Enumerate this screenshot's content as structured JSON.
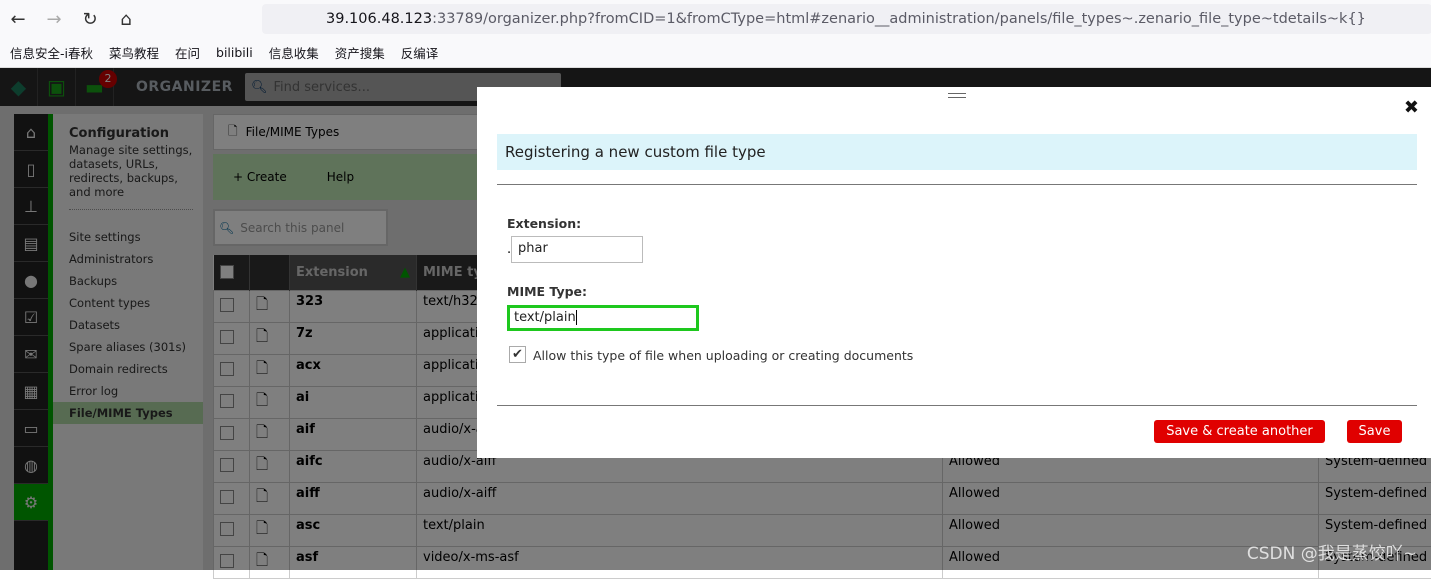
{
  "browser": {
    "url_host": "39.106.48.123",
    "url_rest": ":33789/organizer.php?fromCID=1&fromCType=html#zenario__administration/panels/file_types~.zenario_file_type~tdetails~k{}",
    "bookmarks": [
      "信息安全-i春秋",
      "菜鸟教程",
      "在问",
      "bilibili",
      "信息收集",
      "资产搜集",
      "反编译"
    ]
  },
  "topbar": {
    "badge": "2",
    "title": "ORGANIZER",
    "find_placeholder": "Find services..."
  },
  "config": {
    "title": "Configuration",
    "desc": "Manage site settings, datasets, URLs, redirects, backups, and more",
    "items": [
      "Site settings",
      "Administrators",
      "Backups",
      "Content types",
      "Datasets",
      "Spare aliases (301s)",
      "Domain redirects",
      "Error log",
      "File/MIME Types"
    ]
  },
  "panel": {
    "title": "File/MIME Types",
    "create": "+ Create",
    "help": "Help",
    "search_placeholder": "Search this panel",
    "columns": [
      "Extension",
      "MIME typ"
    ],
    "rows": [
      [
        "323",
        "text/h32",
        "",
        ""
      ],
      [
        "7z",
        "applicatio",
        "",
        ""
      ],
      [
        "acx",
        "applicatio",
        "",
        ""
      ],
      [
        "ai",
        "applicatio",
        "",
        ""
      ],
      [
        "aif",
        "audio/x-a",
        "",
        ""
      ],
      [
        "aifc",
        "audio/x-aiff",
        "Allowed",
        "System-defined"
      ],
      [
        "aiff",
        "audio/x-aiff",
        "Allowed",
        "System-defined"
      ],
      [
        "asc",
        "text/plain",
        "Allowed",
        "System-defined"
      ],
      [
        "asf",
        "video/x-ms-asf",
        "Allowed",
        "System-defined"
      ]
    ]
  },
  "modal": {
    "heading": "Registering a new custom file type",
    "ext_label": "Extension:",
    "ext_value": "phar",
    "mime_label": "MIME Type:",
    "mime_value": "text/plain",
    "allow_label": "Allow this type of file when uploading or creating documents",
    "allow_checked": true,
    "save_another": "Save & create another",
    "save": "Save"
  },
  "watermark": "CSDN @我是蒸饺吖~"
}
